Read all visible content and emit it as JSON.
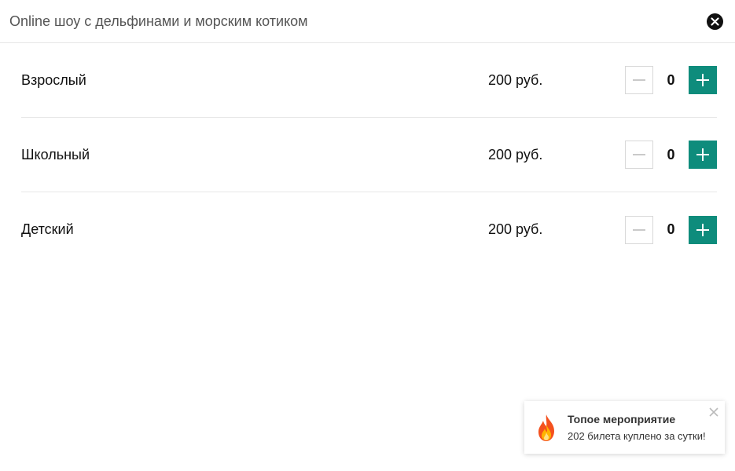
{
  "header": {
    "title": "Online шоу с дельфинами и морским котиком",
    "close_icon": "close-icon"
  },
  "tickets": [
    {
      "label": "Взрослый",
      "price": "200 руб.",
      "quantity": "0"
    },
    {
      "label": "Школьный",
      "price": "200 руб.",
      "quantity": "0"
    },
    {
      "label": "Детский",
      "price": "200 руб.",
      "quantity": "0"
    }
  ],
  "toast": {
    "title": "Топое мероприятие",
    "body": "202 билета куплено за сутки!",
    "icon": "fire-icon"
  },
  "colors": {
    "accent": "#0e8c7c",
    "divider": "#e6e6e6"
  }
}
